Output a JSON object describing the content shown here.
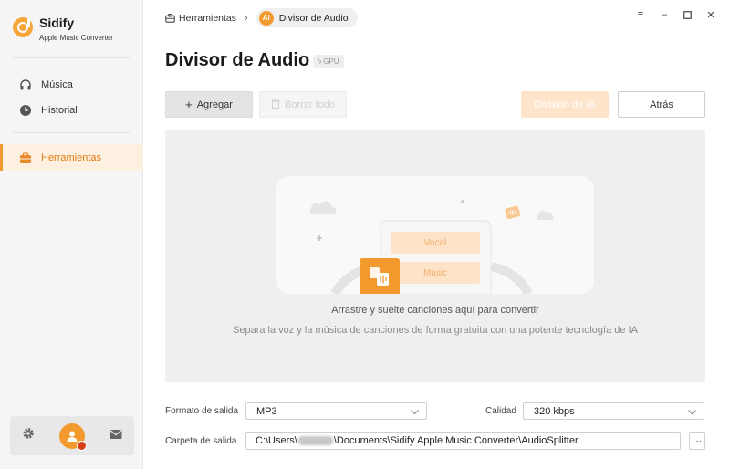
{
  "app": {
    "name": "Sidify",
    "subtitle": "Apple Music Converter",
    "accent_color": "#f29a2e"
  },
  "sidebar": {
    "items": [
      {
        "label": "Música",
        "icon": "headphones-icon",
        "active": false
      },
      {
        "label": "Historial",
        "icon": "clock-icon",
        "active": false
      },
      {
        "label": "Herramientas",
        "icon": "toolbox-icon",
        "active": true
      }
    ],
    "bottom_icons": [
      "settings-icon",
      "user-avatar",
      "mail-icon"
    ]
  },
  "breadcrumb": {
    "parent": "Herramientas",
    "current": "Divisor de Audio",
    "current_badge": "Ai"
  },
  "window_controls": [
    "menu-icon",
    "minimize-icon",
    "maximize-icon",
    "close-icon"
  ],
  "page": {
    "title": "Divisor de Audio",
    "gpu_badge": "GPU"
  },
  "toolbar": {
    "add_label": "Agregar",
    "delete_all_label": "Borrar todo",
    "ai_split_label": "División de IA",
    "back_label": "Atrás"
  },
  "dropzone": {
    "vocal_label": "Vocal",
    "music_label": "Music",
    "main_text": "Arrastre y suelte canciones aquí para convertir",
    "sub_text": "Separa la voz y la música de canciones de forma gratuita con una potente tecnología de IA"
  },
  "output": {
    "format_label": "Formato de salida",
    "format_value": "MP3",
    "quality_label": "Calidad",
    "quality_value": "320 kbps",
    "folder_label": "Carpeta de salida",
    "folder_prefix": "C:\\Users\\",
    "folder_suffix": "\\Documents\\Sidify Apple Music Converter\\AudioSplitter",
    "browse_label": "···"
  }
}
